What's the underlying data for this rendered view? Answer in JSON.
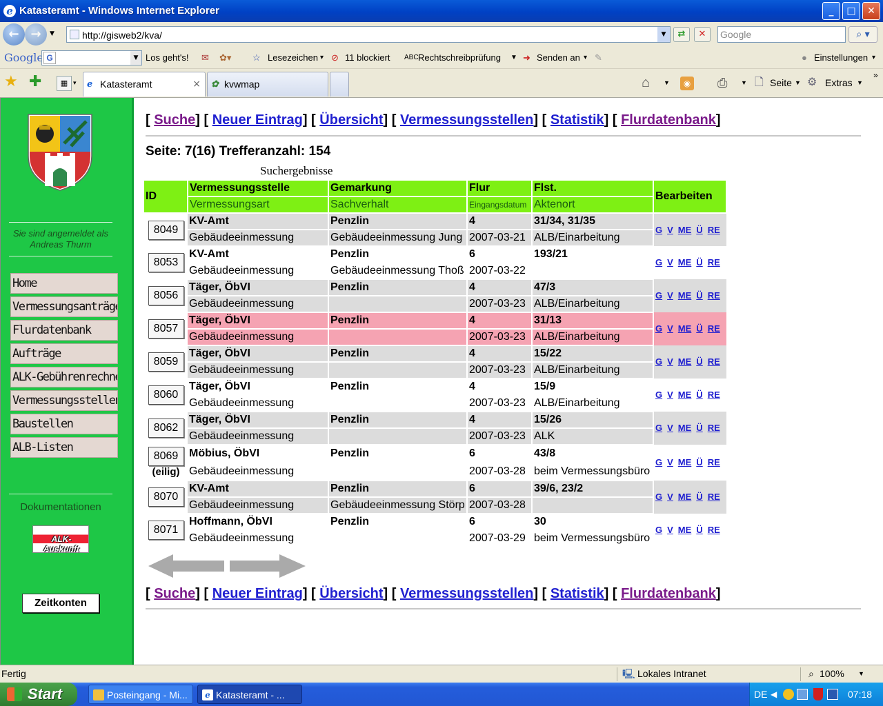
{
  "window": {
    "title": "Katasteramt - Windows Internet Explorer",
    "minimize": "_",
    "maximize": "□",
    "close": "✕"
  },
  "addressbar": {
    "url": "http://gisweb2/kva/",
    "search_placeholder": "Google"
  },
  "google_toolbar": {
    "logo": "Google",
    "go": "Los geht's!",
    "bookmarks": "Lesezeichen",
    "blocked": "11 blockiert",
    "spellcheck": "Rechtschreibprüfung",
    "send": "Senden an",
    "settings": "Einstellungen"
  },
  "tabs": [
    {
      "label": "Katasteramt"
    },
    {
      "label": "kvwmap"
    }
  ],
  "commandbar": {
    "page": "Seite",
    "extras": "Extras"
  },
  "sidebar": {
    "login_line1": "Sie sind angemeldet als",
    "login_line2": "Andreas Thurm",
    "menu": [
      "Home",
      "Vermessungsanträge",
      "Flurdatenbank",
      "Aufträge",
      "ALK-Gebührenrechner",
      "Vermessungsstellen",
      "Baustellen",
      "ALB-Listen"
    ],
    "doc_title": "Dokumentationen",
    "alk_logo": "ALK-Auskunft",
    "zeitkonten": "Zeitkonten"
  },
  "nav": [
    "Suche",
    "Neuer Eintrag",
    "Übersicht",
    "Vermessungsstellen",
    "Statistik",
    "Flurdatenbank"
  ],
  "page_info": "Seite: 7(16)  Trefferanzahl: 154",
  "results_title": "Suchergebnisse",
  "table_headers": {
    "id": "ID",
    "row1": [
      "Vermessungsstelle",
      "Gemarkung",
      "Flur",
      "Flst."
    ],
    "row2": [
      "Vermessungsart",
      "Sachverhalt",
      "Eingangsdatum",
      "Aktenort"
    ],
    "edit": "Bearbeiten"
  },
  "edit_links": [
    "G",
    "V",
    "ME",
    "Ü",
    "RE"
  ],
  "rows": [
    {
      "id": "8049",
      "stelle": "KV-Amt",
      "gemarkung": "Penzlin",
      "flur": "4",
      "flst": "31/34, 31/35",
      "art": "Gebäudeeinmessung",
      "sach": "Gebäudeeinmessung Jung",
      "datum": "2007-03-21",
      "akte": "ALB/Einarbeitung",
      "eilig": "",
      "style": "a"
    },
    {
      "id": "8053",
      "stelle": "KV-Amt",
      "gemarkung": "Penzlin",
      "flur": "6",
      "flst": "193/21",
      "art": "Gebäudeeinmessung",
      "sach": "Gebäudeeinmessung Thoß",
      "datum": "2007-03-22",
      "akte": "",
      "eilig": "",
      "style": "b"
    },
    {
      "id": "8056",
      "stelle": "Täger, ÖbVI",
      "gemarkung": "Penzlin",
      "flur": "4",
      "flst": "47/3",
      "art": "Gebäudeeinmessung",
      "sach": "",
      "datum": "2007-03-23",
      "akte": "ALB/Einarbeitung",
      "eilig": "",
      "style": "a"
    },
    {
      "id": "8057",
      "stelle": "Täger, ÖbVI",
      "gemarkung": "Penzlin",
      "flur": "4",
      "flst": "31/13",
      "art": "Gebäudeeinmessung",
      "sach": "",
      "datum": "2007-03-23",
      "akte": "ALB/Einarbeitung",
      "eilig": "",
      "style": "h"
    },
    {
      "id": "8059",
      "stelle": "Täger, ÖbVI",
      "gemarkung": "Penzlin",
      "flur": "4",
      "flst": "15/22",
      "art": "Gebäudeeinmessung",
      "sach": "",
      "datum": "2007-03-23",
      "akte": "ALB/Einarbeitung",
      "eilig": "",
      "style": "a"
    },
    {
      "id": "8060",
      "stelle": "Täger, ÖbVI",
      "gemarkung": "Penzlin",
      "flur": "4",
      "flst": "15/9",
      "art": "Gebäudeeinmessung",
      "sach": "",
      "datum": "2007-03-23",
      "akte": "ALB/Einarbeitung",
      "eilig": "",
      "style": "b"
    },
    {
      "id": "8062",
      "stelle": "Täger, ÖbVI",
      "gemarkung": "Penzlin",
      "flur": "4",
      "flst": "15/26",
      "art": "Gebäudeeinmessung",
      "sach": "",
      "datum": "2007-03-23",
      "akte": "ALK",
      "eilig": "",
      "style": "a"
    },
    {
      "id": "8069",
      "stelle": "Möbius, ÖbVI",
      "gemarkung": "Penzlin",
      "flur": "6",
      "flst": "43/8",
      "art": "Gebäudeeinmessung",
      "sach": "",
      "datum": "2007-03-28",
      "akte": "beim Vermessungsbüro",
      "eilig": "(eilig)",
      "style": "b"
    },
    {
      "id": "8070",
      "stelle": "KV-Amt",
      "gemarkung": "Penzlin",
      "flur": "6",
      "flst": "39/6, 23/2",
      "art": "Gebäudeeinmessung",
      "sach": "Gebäudeeinmessung Störp",
      "datum": "2007-03-28",
      "akte": "",
      "eilig": "",
      "style": "a"
    },
    {
      "id": "8071",
      "stelle": "Hoffmann, ÖbVI",
      "gemarkung": "Penzlin",
      "flur": "6",
      "flst": "30",
      "art": "Gebäudeeinmessung",
      "sach": "",
      "datum": "2007-03-29",
      "akte": "beim Vermessungsbüro",
      "eilig": "",
      "style": "b"
    }
  ],
  "statusbar": {
    "status": "Fertig",
    "zone": "Lokales Intranet",
    "zoom": "100%"
  },
  "taskbar": {
    "start": "Start",
    "items": [
      "Posteingang - Mi...",
      "Katasteramt - ..."
    ],
    "lang": "DE",
    "clock": "07:18"
  }
}
